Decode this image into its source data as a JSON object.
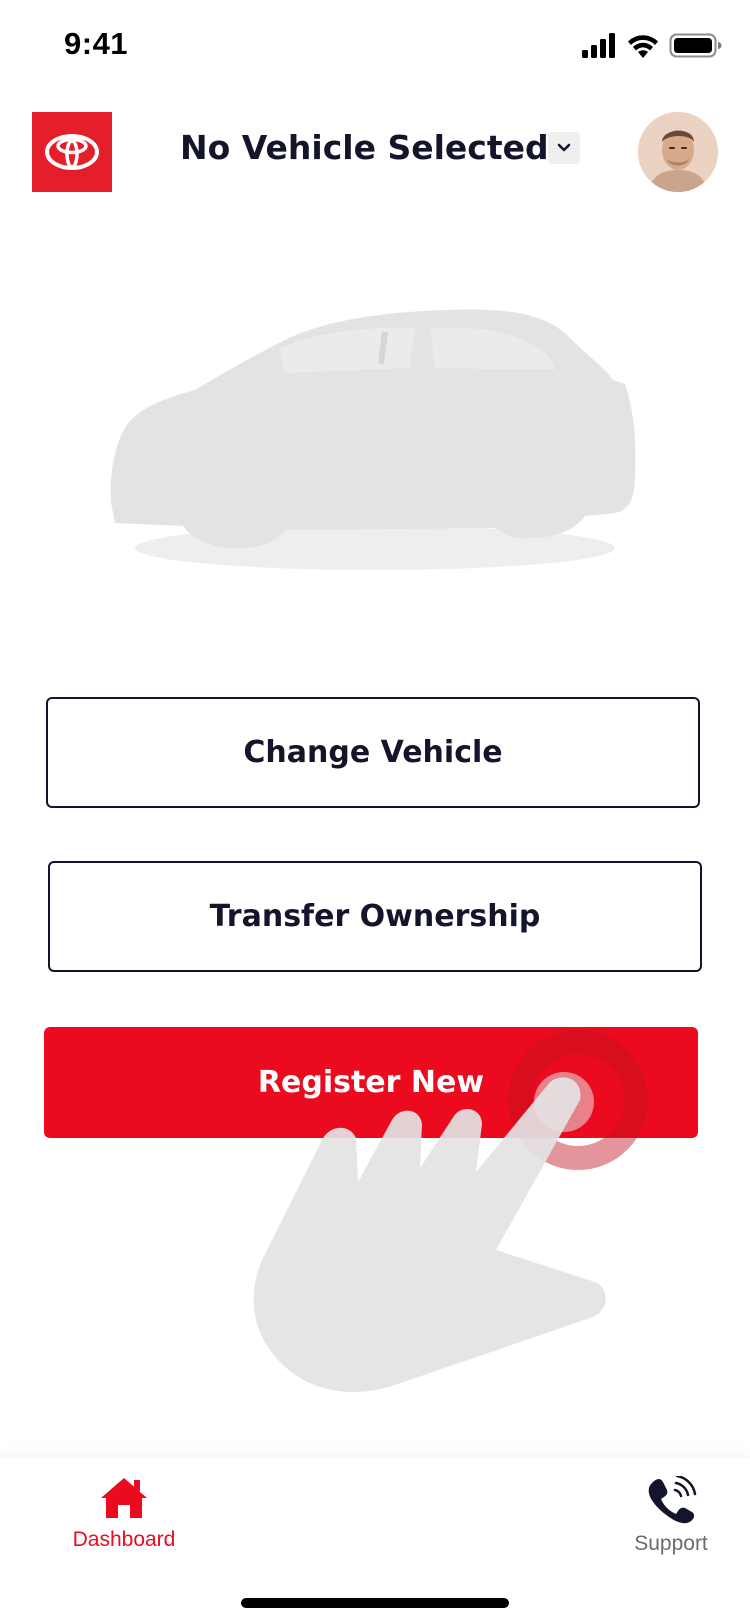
{
  "status_bar": {
    "time": "9:41",
    "icons": [
      "signal-icon",
      "wifi-icon",
      "battery-icon"
    ]
  },
  "header": {
    "logo": "toyota-logo-icon",
    "vehicle_title": "No Vehicle Selected",
    "dropdown_icon": "chevron-down-icon",
    "avatar": "user-avatar"
  },
  "hero": {
    "image": "car-silhouette-placeholder"
  },
  "actions": {
    "change_vehicle": "Change Vehicle",
    "transfer_ownership": "Transfer Ownership",
    "register_new": "Register New"
  },
  "overlay": {
    "icon": "tap-hand-icon"
  },
  "tab_bar": {
    "tabs": [
      {
        "label": "Dashboard",
        "icon": "home-icon",
        "active": true
      },
      {
        "label": "Support",
        "icon": "phone-icon",
        "active": false
      }
    ]
  },
  "colors": {
    "brand_red": "#eb0a1e",
    "logo_red": "#e51f29",
    "text_dark": "#14142b",
    "inactive_gray": "#6b6b6b",
    "silhouette_gray": "#e3e3e3"
  }
}
